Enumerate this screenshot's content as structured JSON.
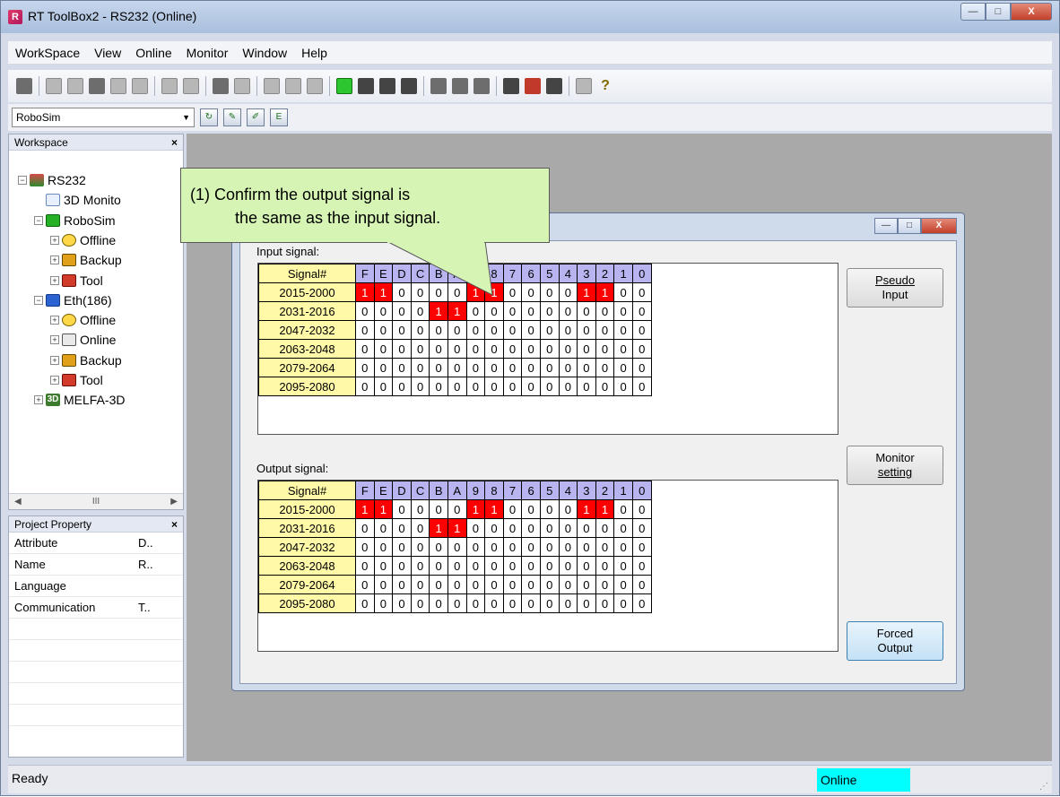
{
  "window": {
    "title": "RT ToolBox2 - RS232  (Online)",
    "min": "—",
    "max": "□",
    "close": "X"
  },
  "menu": [
    "WorkSpace",
    "View",
    "Online",
    "Monitor",
    "Window",
    "Help"
  ],
  "toolbar2": {
    "combo_value": "RoboSim"
  },
  "workspace": {
    "title": "Workspace",
    "tree": [
      {
        "label": "RS232",
        "level": 0,
        "icon": "rs232-icon"
      },
      {
        "label": "3D Monito",
        "level": 1,
        "icon": "3d-monitor-icon"
      },
      {
        "label": "RoboSim",
        "level": 1,
        "icon": "robosim-icon"
      },
      {
        "label": "Offline",
        "level": 2,
        "icon": "offline-icon"
      },
      {
        "label": "Backup",
        "level": 2,
        "icon": "backup-icon"
      },
      {
        "label": "Tool",
        "level": 2,
        "icon": "tool-icon"
      },
      {
        "label": "Eth(186)",
        "level": 1,
        "icon": "ethernet-icon"
      },
      {
        "label": "Offline",
        "level": 2,
        "icon": "offline-icon"
      },
      {
        "label": "Online",
        "level": 2,
        "icon": "online-icon"
      },
      {
        "label": "Backup",
        "level": 2,
        "icon": "backup-icon"
      },
      {
        "label": "Tool",
        "level": 2,
        "icon": "tool-icon"
      },
      {
        "label": "MELFA-3D",
        "level": 1,
        "icon": "melfa-3d-icon"
      }
    ],
    "scroll_mid": "III"
  },
  "project_property": {
    "title": "Project Property",
    "rows": [
      {
        "k": "Attribute",
        "v": "D.."
      },
      {
        "k": "Name",
        "v": "R.."
      },
      {
        "k": "Language",
        "v": ""
      },
      {
        "k": "Communication",
        "v": "T.."
      }
    ]
  },
  "monitor": {
    "input_label": "Input signal:",
    "output_label": "Output signal:",
    "header_name": "Signal#",
    "bits": [
      "F",
      "E",
      "D",
      "C",
      "B",
      "A",
      "9",
      "8",
      "7",
      "6",
      "5",
      "4",
      "3",
      "2",
      "1",
      "0"
    ],
    "input_rows": [
      {
        "name": "2015-2000",
        "vals": [
          1,
          1,
          0,
          0,
          0,
          0,
          1,
          1,
          0,
          0,
          0,
          0,
          1,
          1,
          0,
          0
        ]
      },
      {
        "name": "2031-2016",
        "vals": [
          0,
          0,
          0,
          0,
          1,
          1,
          0,
          0,
          0,
          0,
          0,
          0,
          0,
          0,
          0,
          0
        ]
      },
      {
        "name": "2047-2032",
        "vals": [
          0,
          0,
          0,
          0,
          0,
          0,
          0,
          0,
          0,
          0,
          0,
          0,
          0,
          0,
          0,
          0
        ]
      },
      {
        "name": "2063-2048",
        "vals": [
          0,
          0,
          0,
          0,
          0,
          0,
          0,
          0,
          0,
          0,
          0,
          0,
          0,
          0,
          0,
          0
        ]
      },
      {
        "name": "2079-2064",
        "vals": [
          0,
          0,
          0,
          0,
          0,
          0,
          0,
          0,
          0,
          0,
          0,
          0,
          0,
          0,
          0,
          0
        ]
      },
      {
        "name": "2095-2080",
        "vals": [
          0,
          0,
          0,
          0,
          0,
          0,
          0,
          0,
          0,
          0,
          0,
          0,
          0,
          0,
          0,
          0
        ]
      }
    ],
    "output_rows": [
      {
        "name": "2015-2000",
        "vals": [
          1,
          1,
          0,
          0,
          0,
          0,
          1,
          1,
          0,
          0,
          0,
          0,
          1,
          1,
          0,
          0
        ]
      },
      {
        "name": "2031-2016",
        "vals": [
          0,
          0,
          0,
          0,
          1,
          1,
          0,
          0,
          0,
          0,
          0,
          0,
          0,
          0,
          0,
          0
        ]
      },
      {
        "name": "2047-2032",
        "vals": [
          0,
          0,
          0,
          0,
          0,
          0,
          0,
          0,
          0,
          0,
          0,
          0,
          0,
          0,
          0,
          0
        ]
      },
      {
        "name": "2063-2048",
        "vals": [
          0,
          0,
          0,
          0,
          0,
          0,
          0,
          0,
          0,
          0,
          0,
          0,
          0,
          0,
          0,
          0
        ]
      },
      {
        "name": "2079-2064",
        "vals": [
          0,
          0,
          0,
          0,
          0,
          0,
          0,
          0,
          0,
          0,
          0,
          0,
          0,
          0,
          0,
          0
        ]
      },
      {
        "name": "2095-2080",
        "vals": [
          0,
          0,
          0,
          0,
          0,
          0,
          0,
          0,
          0,
          0,
          0,
          0,
          0,
          0,
          0,
          0
        ]
      }
    ],
    "pseudo_input_l1": "Pseudo",
    "pseudo_input_l2": "Input",
    "monitor_setting_l1": "Monitor",
    "monitor_setting_l2": "setting",
    "forced_output_l1": "Forced",
    "forced_output_l2": "Output"
  },
  "callout": {
    "line1": "(1)  Confirm the output signal is",
    "line2": "the same as the input signal."
  },
  "status": {
    "ready": "Ready",
    "mode": "Online"
  },
  "colors": {
    "on": "#ff0000",
    "name_cell": "#fff9a8",
    "bit_header": "#b7b4f0",
    "callout": "#d6f5b4",
    "online": "#00ffff"
  }
}
